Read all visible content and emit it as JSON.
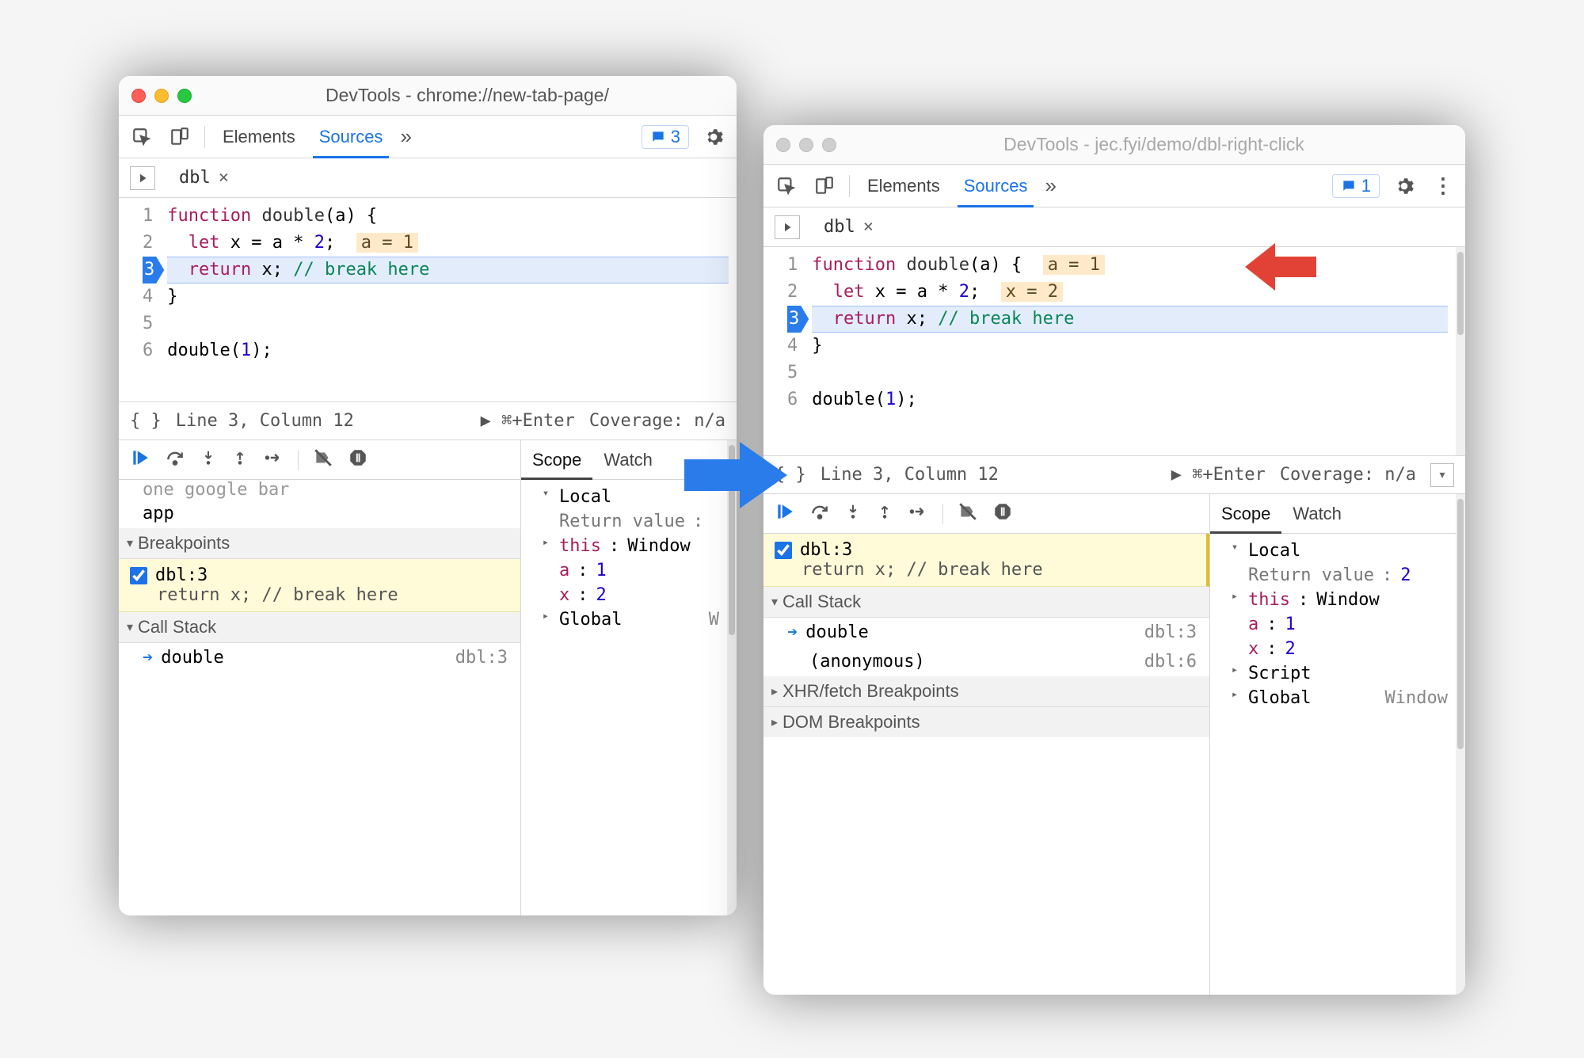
{
  "left": {
    "title_prefix": "DevTools - ",
    "title_url": "chrome://new-tab-page/",
    "tabs": {
      "elements": "Elements",
      "sources": "Sources"
    },
    "issues_count": "3",
    "file_tab": "dbl",
    "code": {
      "lines": [
        "1",
        "2",
        "3",
        "4",
        "5",
        "6"
      ],
      "l1_kw": "function",
      "l1_fn": "double",
      "l1_rest": "(a) {",
      "l2_kw": "let",
      "l2_rest": " x = a * ",
      "l2_num": "2",
      "l2_semi": ";",
      "l2_hint": "a = 1",
      "l3_kw": "return",
      "l3_rest": " x; ",
      "l3_comment": "// break here",
      "l4": "}",
      "l6_call": "double(",
      "l6_num": "1",
      "l6_end": ");"
    },
    "status": {
      "pos": "Line 3, Column 12",
      "run": "▶ ⌘+Enter",
      "cov": "Coverage: n/a"
    },
    "debug": {
      "resume": "▶",
      "stepover": "↷",
      "stepin": "↧",
      "stepout": "↥",
      "step": "→",
      "breakpoints": "⫽",
      "pause": "⏸",
      "scope_tab": "Scope",
      "watch_tab": "Watch",
      "row_app": "app",
      "breakpoints_hdr": "Breakpoints",
      "bp_name": "dbl:3",
      "bp_code": "return x; // break here",
      "callstack_hdr": "Call Stack",
      "frame": "double",
      "frame_loc": "dbl:3",
      "scope_local": "Local",
      "scope_ret_lbl": "Return value",
      "scope_this": "this",
      "scope_this_val": "Window",
      "scope_a": "a",
      "scope_a_val": "1",
      "scope_x": "x",
      "scope_x_val": "2",
      "scope_global": "Global",
      "scope_global_right": "W"
    }
  },
  "right": {
    "title_prefix": "DevTools - ",
    "title_url": "jec.fyi/demo/dbl-right-click",
    "tabs": {
      "elements": "Elements",
      "sources": "Sources"
    },
    "issues_count": "1",
    "file_tab": "dbl",
    "code": {
      "lines": [
        "1",
        "2",
        "3",
        "4",
        "5",
        "6"
      ],
      "l1_kw": "function",
      "l1_fn": "double",
      "l1_rest": "(a) {",
      "l1_hint": "a = 1",
      "l2_kw": "let",
      "l2_rest": " x = a * ",
      "l2_num": "2",
      "l2_semi": ";",
      "l2_hint": "x = 2",
      "l3_kw": "return",
      "l3_rest": " x; ",
      "l3_comment": "// break here",
      "l4": "}",
      "l6_call": "double(",
      "l6_num": "1",
      "l6_end": ");"
    },
    "status": {
      "pos": "Line 3, Column 12",
      "run": "▶ ⌘+Enter",
      "cov": "Coverage: n/a"
    },
    "debug": {
      "scope_tab": "Scope",
      "watch_tab": "Watch",
      "bp_name": "dbl:3",
      "bp_code": "return x; // break here",
      "callstack_hdr": "Call Stack",
      "frame1": "double",
      "frame1_loc": "dbl:3",
      "frame2": "(anonymous)",
      "frame2_loc": "dbl:6",
      "xhr_hdr": "XHR/fetch Breakpoints",
      "dom_hdr": "DOM Breakpoints",
      "scope_local": "Local",
      "scope_ret_lbl": "Return value",
      "scope_ret_val": "2",
      "scope_this": "this",
      "scope_this_val": "Window",
      "scope_a": "a",
      "scope_a_val": "1",
      "scope_x": "x",
      "scope_x_val": "2",
      "scope_script": "Script",
      "scope_global": "Global",
      "scope_global_right": "Window"
    }
  }
}
